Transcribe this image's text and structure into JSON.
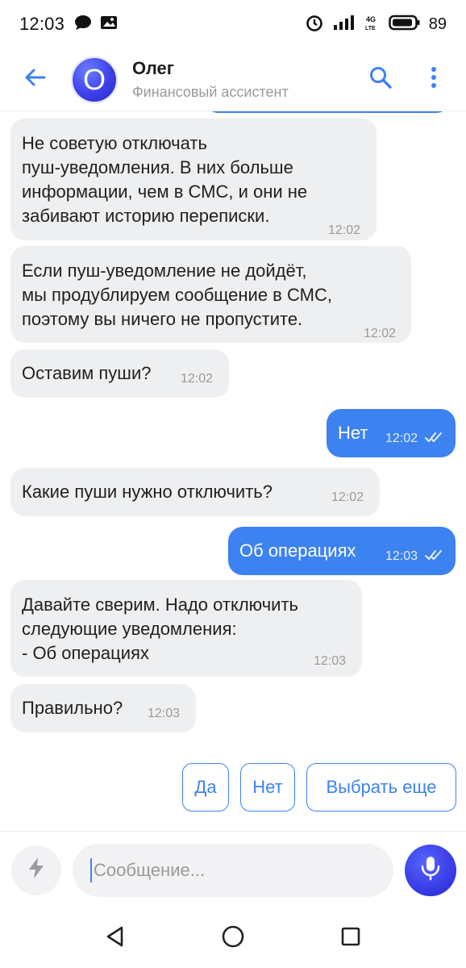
{
  "status_bar": {
    "time": "12:03",
    "battery": "89",
    "network": "4G LTE"
  },
  "header": {
    "name": "Олег",
    "subtitle": "Финансовый ассистент",
    "avatar_letter": "O"
  },
  "messages": [
    {
      "dir": "in",
      "text": "Не советую отключать\nпуш-уведомления. В них больше\nинформации, чем в СМС, и они не\nзабивают историю переписки.",
      "time": "12:02"
    },
    {
      "dir": "in",
      "text": "Если пуш-уведомление не дойдёт,\nмы продублируем сообщение в СМС,\nпоэтому вы ничего не пропустите.",
      "time": "12:02"
    },
    {
      "dir": "in",
      "text": "Оставим пуши?",
      "time": "12:02"
    },
    {
      "dir": "out",
      "text": "Нет",
      "time": "12:02"
    },
    {
      "dir": "in",
      "text": "Какие пуши нужно отключить?",
      "time": "12:02"
    },
    {
      "dir": "out",
      "text": "Об операциях",
      "time": "12:03"
    },
    {
      "dir": "in",
      "text": "Давайте сверим. Надо отключить\nследующие уведомления:\n- Об операциях",
      "time": "12:03"
    },
    {
      "dir": "in",
      "text": "Правильно?",
      "time": "12:03"
    }
  ],
  "quick_replies": [
    "Да",
    "Нет",
    "Выбрать еще"
  ],
  "composer": {
    "placeholder": "Сообщение..."
  },
  "colors": {
    "accent": "#3d82f1",
    "bubble_in": "#eeeff1",
    "avatar": "#3b3ee8"
  }
}
